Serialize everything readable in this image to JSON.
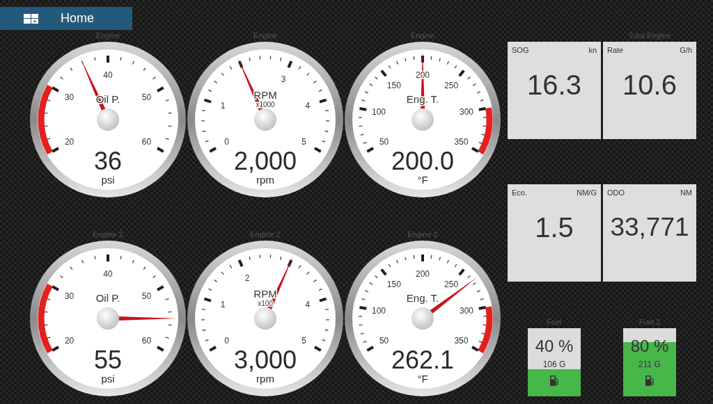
{
  "header": {
    "title": "Home"
  },
  "gauges": [
    {
      "caption": "Engine",
      "label": "Oil P.",
      "scale": [
        "20",
        "30",
        "40",
        "50",
        "60"
      ],
      "value": "36",
      "unit": "psi",
      "level": 0.4,
      "kind": "lowwarning"
    },
    {
      "caption": "Engine",
      "label": "RPM",
      "multiplier": "x1000",
      "scale": [
        "0",
        "1",
        "3",
        "4",
        "5"
      ],
      "value": "2,000",
      "unit": "rpm",
      "level": 0.4,
      "kind": "plain"
    },
    {
      "caption": "Engine",
      "label": "Eng. T.",
      "scale": [
        "50",
        "100",
        "150",
        "200",
        "250",
        "300",
        "350"
      ],
      "value": "200.0",
      "unit": "°F",
      "level": 0.5,
      "kind": "highwarning"
    },
    {
      "caption": "Engine 2",
      "label": "Oil P.",
      "scale": [
        "20",
        "30",
        "40",
        "50",
        "60"
      ],
      "value": "55",
      "unit": "psi",
      "level": 0.875,
      "kind": "lowwarning"
    },
    {
      "caption": "Engine 2",
      "label": "RPM",
      "multiplier": "x100",
      "scale": [
        "0",
        "1",
        "2",
        "4",
        "5"
      ],
      "value": "3,000",
      "unit": "rpm",
      "level": 0.6,
      "kind": "plain"
    },
    {
      "caption": "Engine 2",
      "label": "Eng. T.",
      "scale": [
        "50",
        "100",
        "150",
        "200",
        "250",
        "300",
        "350"
      ],
      "value": "262.1",
      "unit": "°F",
      "level": 0.72,
      "kind": "highwarning"
    }
  ],
  "data_panel": {
    "caption": "Total Engine",
    "boxes": [
      {
        "title": "SOG",
        "unit": "kn",
        "value": "16.3"
      },
      {
        "title": "Rate",
        "unit": "G/h",
        "value": "10.6"
      },
      {
        "title": "Eco.",
        "unit": "NM/G",
        "value": "1.5"
      },
      {
        "title": "ODO",
        "unit": "NM",
        "value": "33,771"
      }
    ]
  },
  "fuel_tanks": [
    {
      "caption": "Fuel",
      "percent": "40 %",
      "amount": "106 G",
      "level": 0.4
    },
    {
      "caption": "Fuel 2",
      "percent": "80 %",
      "amount": "211 G",
      "level": 0.8
    }
  ]
}
